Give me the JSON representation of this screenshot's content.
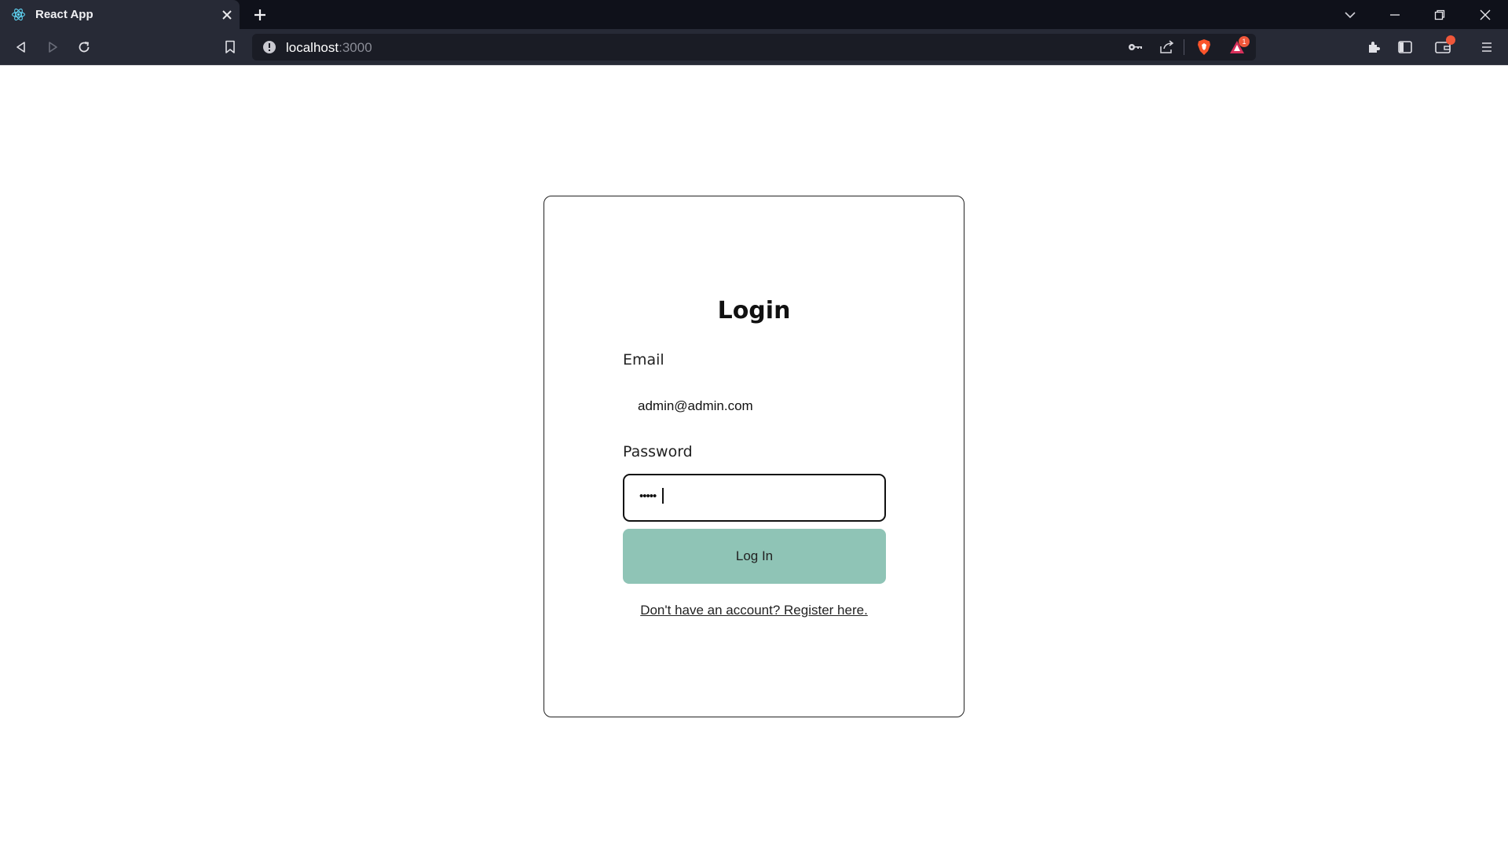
{
  "browser": {
    "tab": {
      "title": "React App",
      "favicon": "react-icon"
    },
    "url": {
      "host": "localhost",
      "port": ":3000"
    },
    "extension_badge_count": "1"
  },
  "login": {
    "title": "Login",
    "email_label": "Email",
    "email_value": "admin@admin.com",
    "password_label": "Password",
    "password_mask": "•••••",
    "submit_label": "Log In",
    "register_link": "Don't have an account? Register here."
  },
  "colors": {
    "button_bg": "#8fc4b6",
    "chrome_bg": "#272a36",
    "titlebar_bg": "#0f111a"
  }
}
